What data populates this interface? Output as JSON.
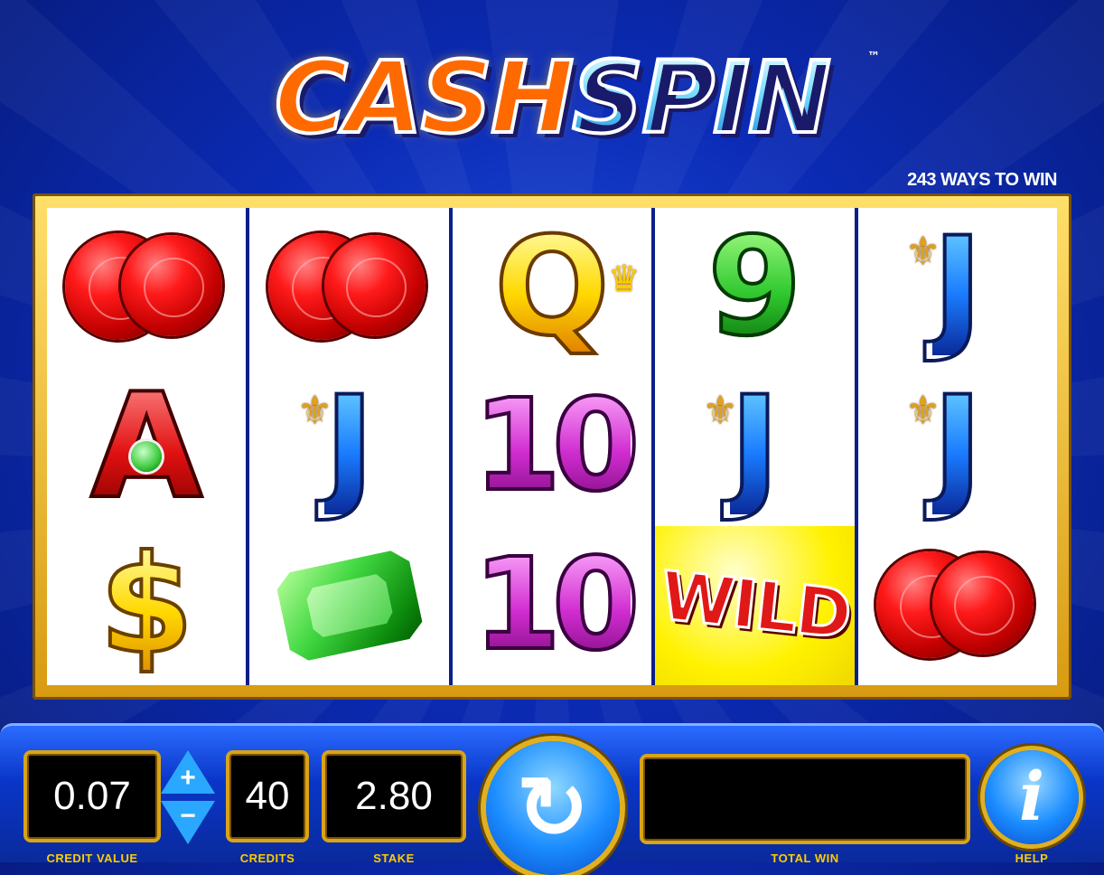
{
  "game": {
    "logo_part1": "CASH",
    "logo_part2": "SPIN",
    "trademark": "™",
    "ways_to_win": "243 WAYS TO WIN"
  },
  "reels": [
    [
      "ruby-pair",
      "A",
      "$"
    ],
    [
      "ruby-pair",
      "J",
      "emerald"
    ],
    [
      "Q",
      "10",
      "10"
    ],
    [
      "9",
      "J",
      "WILD"
    ],
    [
      "J",
      "J",
      "ruby-pair"
    ]
  ],
  "controls": {
    "credit_value": "0.07",
    "credit_value_label": "CREDIT VALUE",
    "increase_symbol": "+",
    "decrease_symbol": "−",
    "credits": "40",
    "credits_label": "CREDITS",
    "stake": "2.80",
    "stake_label": "STAKE",
    "spin_icon": "↻",
    "total_win": "",
    "total_win_label": "TOTAL WIN",
    "help_icon": "i",
    "help_label": "HELP"
  },
  "colors": {
    "background": "#0b2bb5",
    "frame_gold": "#d89a10",
    "label_gold": "#ffcc00"
  }
}
